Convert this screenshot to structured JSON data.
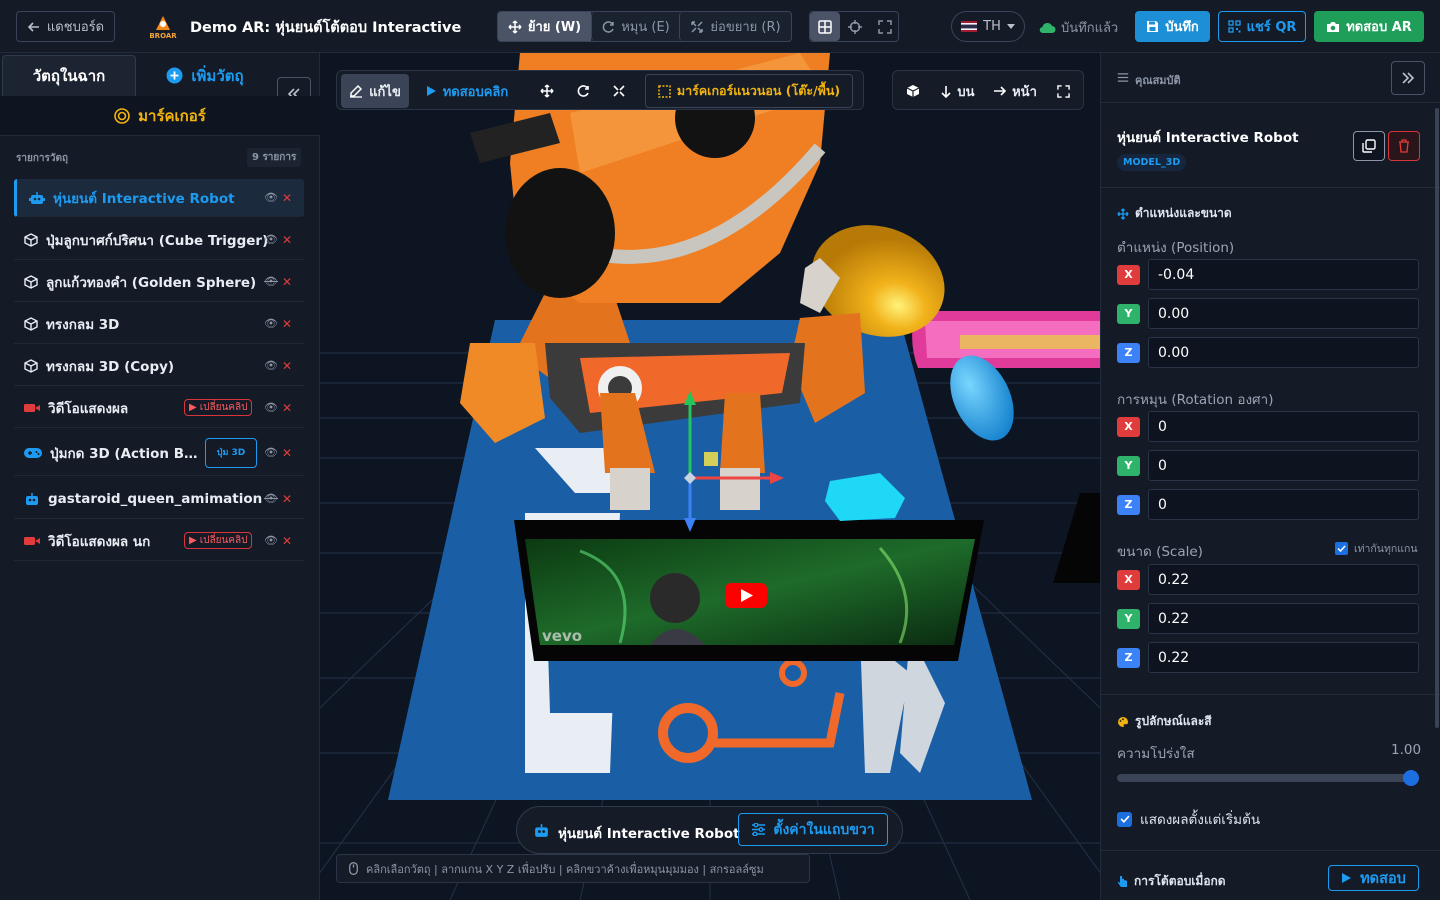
{
  "topbar": {
    "back_label": "แดชบอร์ด",
    "brand_text": "BROAR",
    "title": "Demo AR: หุ่นยนต์โต้ตอบ Interactive",
    "transform_tools": [
      {
        "label": "ย้าย (W)",
        "icon": "move-icon",
        "active": true
      },
      {
        "label": "หมุน (E)",
        "icon": "rotate-icon",
        "active": false
      },
      {
        "label": "ย่อขยาย (R)",
        "icon": "scale-icon",
        "active": false
      }
    ],
    "language": "TH",
    "saved_status": "บันทึกแล้ว",
    "save_label": "บันทึก",
    "share_qr_label": "แชร์ QR",
    "test_ar_label": "ทดสอบ AR"
  },
  "left_panel": {
    "tabs": [
      {
        "label": "วัตถุในฉาก",
        "active": true
      },
      {
        "label": "เพิ่มวัตถุ",
        "active": false
      }
    ],
    "marker_label": "มาร์คเกอร์",
    "list_header": "รายการวัตถุ",
    "list_count": "9 รายการ",
    "objects": [
      {
        "label": "หุ่นยนต์ Interactive Robot",
        "icon": "robot-icon",
        "selected": true,
        "visible": true
      },
      {
        "label": "ปุ่มลูกบาศก์ปริศนา (Cube Trigger)",
        "icon": "cube-icon",
        "selected": false,
        "visible": true
      },
      {
        "label": "ลูกแก้วทองคำ (Golden Sphere)",
        "icon": "cube-icon",
        "selected": false,
        "visible": false
      },
      {
        "label": "ทรงกลม 3D",
        "icon": "cube-icon",
        "selected": false,
        "visible": true
      },
      {
        "label": "ทรงกลม 3D (Copy)",
        "icon": "cube-icon",
        "selected": false,
        "visible": true
      },
      {
        "label": "วิดีโอแสดงผล",
        "icon": "video-icon",
        "selected": false,
        "visible": true,
        "badge": "เปลี่ยนคลิป"
      },
      {
        "label": "ปุ่มกด 3D (Action But...",
        "icon": "gamepad-icon",
        "selected": false,
        "visible": true,
        "badge": "ปุ่ม 3D"
      },
      {
        "label": "gastaroid_queen_amimation",
        "icon": "robot-icon",
        "selected": false,
        "visible": false
      },
      {
        "label": "วิดีโอแสดงผล นก",
        "icon": "video-icon",
        "selected": false,
        "visible": true,
        "badge": "เปลี่ยนคลิป"
      }
    ]
  },
  "viewport": {
    "edit_label": "แก้ไข",
    "test_click_label": "ทดสอบคลิก",
    "marker_mode_label": "มาร์คเกอร์แนวนอน (โต๊ะ/พื้น)",
    "view_top_label": "บน",
    "view_front_label": "หน้า",
    "selected_object": "หุ่นยนต์ Interactive Robot",
    "settings_label": "ตั้งค่าในแถบขวา",
    "hint": "คลิกเลือกวัตถุ | ลากแกน X Y Z เพื่อปรับ | คลิกขวาค้างเพื่อหมุนมุมมอง | สกรอลล์ซูม",
    "video_watermark": "vevo"
  },
  "right_panel": {
    "header": "คุณสมบัติ",
    "object_name": "หุ่นยนต์ Interactive Robot",
    "object_type": "MODEL_3D",
    "transform_section": "ตำแหน่งและขนาด",
    "position_label": "ตำแหน่ง (Position)",
    "position": {
      "x": "-0.04",
      "y": "0.00",
      "z": "0.00"
    },
    "rotation_label": "การหมุน (Rotation องศา)",
    "rotation": {
      "x": "0",
      "y": "0",
      "z": "0"
    },
    "scale_label": "ขนาด (Scale)",
    "uniform_label": "เท่ากันทุกแกน",
    "scale": {
      "x": "0.22",
      "y": "0.22",
      "z": "0.22"
    },
    "appearance_section": "รูปลักษณ์และสี",
    "opacity_label": "ความโปร่งใส",
    "opacity_value": "1.00",
    "opacity": 1.0,
    "show_default_label": "แสดงผลตั้งแต่เริ่มต้น",
    "interaction_section": "การโต้ตอบเมื่อกด",
    "test_label": "ทดสอบ"
  }
}
